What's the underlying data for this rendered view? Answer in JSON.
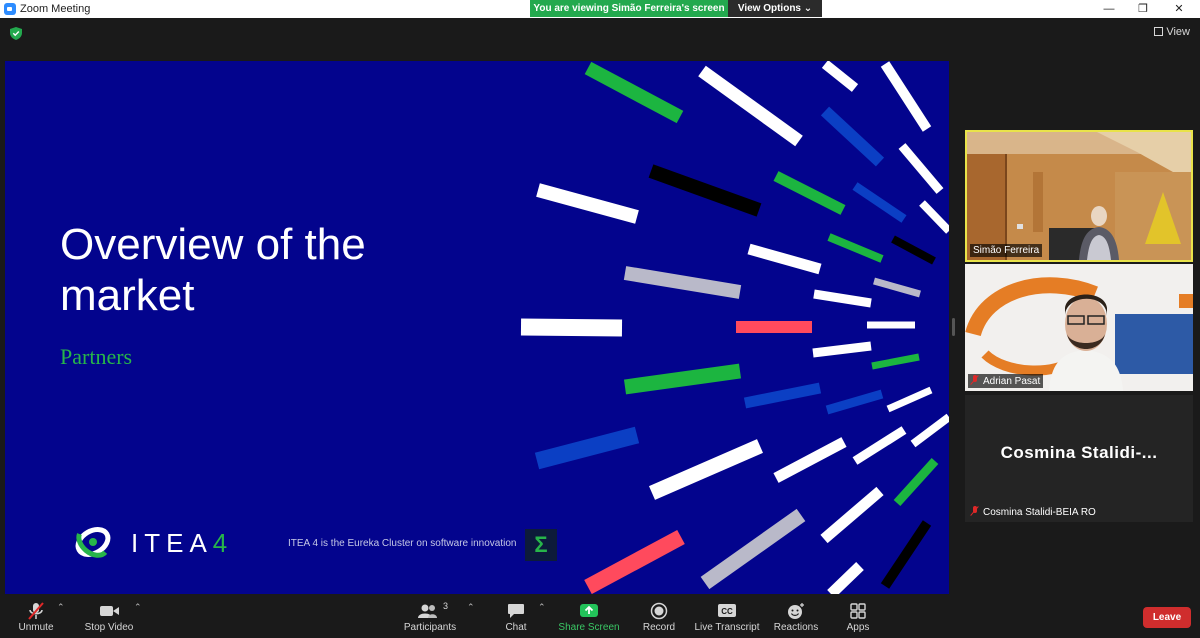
{
  "window": {
    "title": "Zoom Meeting",
    "viewing_banner": "You are viewing Simão Ferreira's screen",
    "view_options": "View Options",
    "view_label": "View"
  },
  "slide": {
    "title": "Overview of the market",
    "subtitle": "Partners",
    "logo_text": "ITEA",
    "logo_number": "4",
    "tagline": "ITEA 4 is the Eureka Cluster on software innovation",
    "badge": "Σ"
  },
  "participants_panel": {
    "tiles": [
      {
        "name": "Simão Ferreira",
        "active": true
      },
      {
        "name": "Adrian Pasat",
        "muted": true
      },
      {
        "name": "Cosmina Stalidi-BEIA RO",
        "display": "Cosmina  Stalidi-...",
        "muted": true
      }
    ]
  },
  "toolbar": {
    "unmute": "Unmute",
    "stop_video": "Stop Video",
    "participants": "Participants",
    "participants_count": "3",
    "chat": "Chat",
    "share_screen": "Share Screen",
    "record": "Record",
    "live_transcript": "Live Transcript",
    "reactions": "Reactions",
    "apps": "Apps",
    "leave": "Leave",
    "cc_icon_text": "CC"
  },
  "colors": {
    "slide_bg": "#03048d",
    "itea_green": "#27b54a",
    "banner_green": "#23a94e",
    "leave_red": "#cf2d2d",
    "active_border": "#e9e34a"
  }
}
